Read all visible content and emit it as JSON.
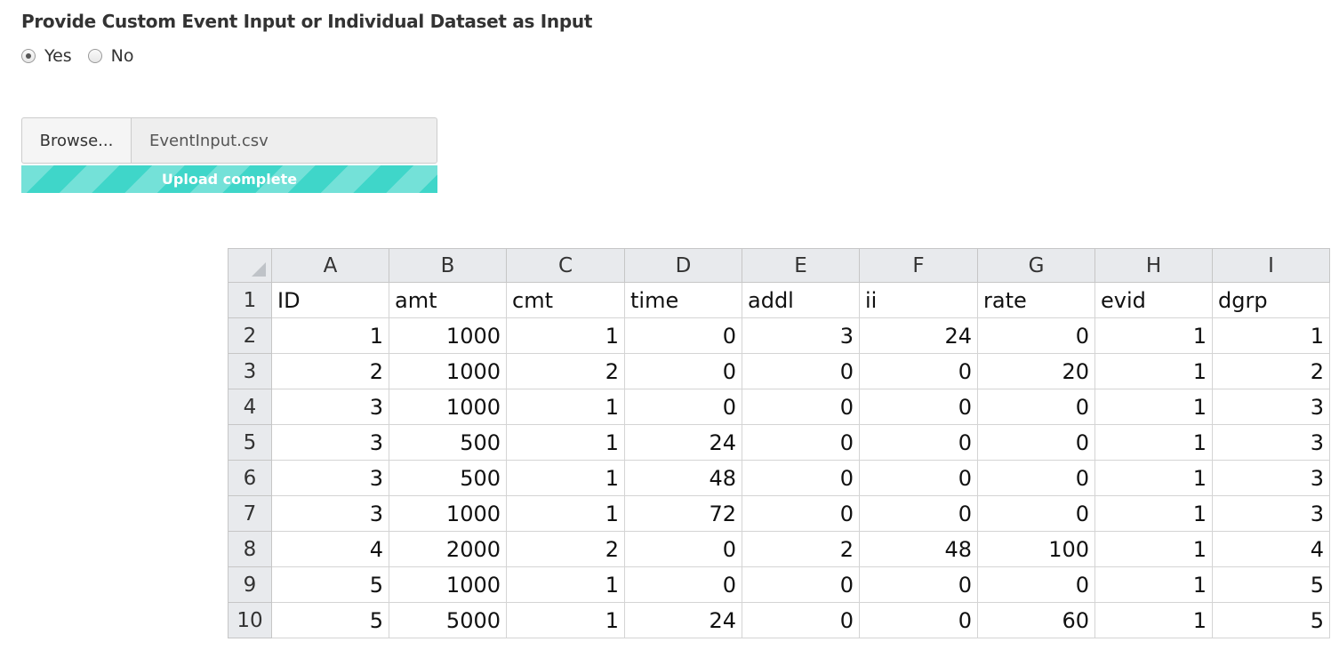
{
  "form": {
    "title": "Provide Custom Event Input or Individual Dataset as Input",
    "options": [
      {
        "label": "Yes",
        "checked": true
      },
      {
        "label": "No",
        "checked": false
      }
    ]
  },
  "file_input": {
    "browse_label": "Browse...",
    "filename": "EventInput.csv",
    "progress_text": "Upload complete",
    "progress_percent": 100,
    "progress_color": "#3fd6c9"
  },
  "spreadsheet": {
    "columns": [
      "A",
      "B",
      "C",
      "D",
      "E",
      "F",
      "G",
      "H",
      "I"
    ],
    "rows": [
      {
        "num": "1",
        "cells": [
          "ID",
          "amt",
          "cmt",
          "time",
          "addl",
          "ii",
          "rate",
          "evid",
          "dgrp"
        ]
      },
      {
        "num": "2",
        "cells": [
          "1",
          "1000",
          "1",
          "0",
          "3",
          "24",
          "0",
          "1",
          "1"
        ]
      },
      {
        "num": "3",
        "cells": [
          "2",
          "1000",
          "2",
          "0",
          "0",
          "0",
          "20",
          "1",
          "2"
        ]
      },
      {
        "num": "4",
        "cells": [
          "3",
          "1000",
          "1",
          "0",
          "0",
          "0",
          "0",
          "1",
          "3"
        ]
      },
      {
        "num": "5",
        "cells": [
          "3",
          "500",
          "1",
          "24",
          "0",
          "0",
          "0",
          "1",
          "3"
        ]
      },
      {
        "num": "6",
        "cells": [
          "3",
          "500",
          "1",
          "48",
          "0",
          "0",
          "0",
          "1",
          "3"
        ]
      },
      {
        "num": "7",
        "cells": [
          "3",
          "1000",
          "1",
          "72",
          "0",
          "0",
          "0",
          "1",
          "3"
        ]
      },
      {
        "num": "8",
        "cells": [
          "4",
          "2000",
          "2",
          "0",
          "2",
          "48",
          "100",
          "1",
          "4"
        ]
      },
      {
        "num": "9",
        "cells": [
          "5",
          "1000",
          "1",
          "0",
          "0",
          "0",
          "0",
          "1",
          "5"
        ]
      },
      {
        "num": "10",
        "cells": [
          "5",
          "5000",
          "1",
          "24",
          "0",
          "0",
          "60",
          "1",
          "5"
        ]
      }
    ]
  }
}
